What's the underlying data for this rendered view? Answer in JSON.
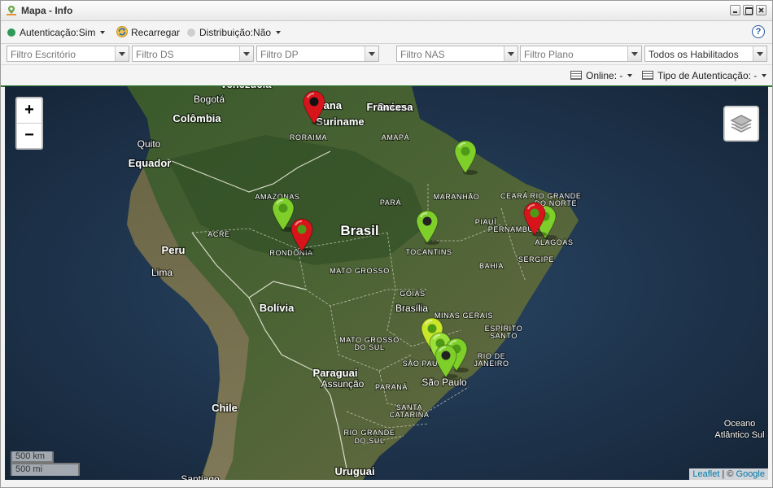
{
  "window": {
    "title": "Mapa - Info"
  },
  "toolbar": {
    "auth": {
      "label": "Autenticação:Sim",
      "dot_color": "#2e9a5a"
    },
    "reload": {
      "label": "Recarregar"
    },
    "distribution": {
      "label": "Distribuição:Não",
      "dot_color": "#cfcfcf"
    },
    "help": "?"
  },
  "filters": [
    {
      "id": "escritorio",
      "placeholder": "Filtro Escritório"
    },
    {
      "id": "ds",
      "placeholder": "Filtro DS"
    },
    {
      "id": "dp",
      "placeholder": "Filtro DP"
    },
    {
      "id": "nas",
      "placeholder": "Filtro NAS"
    },
    {
      "id": "plano",
      "placeholder": "Filtro Plano"
    },
    {
      "id": "habilitados",
      "placeholder": "Todos os Habilitados"
    }
  ],
  "toolbar3": {
    "online": "Online: -",
    "auth_type": "Tipo de Autenticação: -"
  },
  "map": {
    "zoom_in": "+",
    "zoom_out": "−",
    "scale_km": "500 km",
    "scale_mi": "500 mi",
    "attribution_leaflet": "Leaflet",
    "attribution_sep": " | © ",
    "attribution_google": "Google",
    "labels": [
      {
        "text": "Venezuela",
        "size": 13,
        "bold": true
      },
      {
        "text": "Guiana",
        "size": 13,
        "bold": true
      },
      {
        "text": "Guiana",
        "size": 13,
        "bold": true
      },
      {
        "text": "Francesa",
        "size": 13,
        "bold": true
      },
      {
        "text": "Bogotá",
        "size": 12,
        "bold": false
      },
      {
        "text": "Colômbia",
        "size": 13,
        "bold": true
      },
      {
        "text": "Suriname",
        "size": 13,
        "bold": true
      },
      {
        "text": "RORAIMA",
        "size": 9,
        "bold": false
      },
      {
        "text": "AMAPÁ",
        "size": 9,
        "bold": false
      },
      {
        "text": "Quito",
        "size": 12,
        "bold": false
      },
      {
        "text": "Equador",
        "size": 13,
        "bold": true
      },
      {
        "text": "AMAZONAS",
        "size": 9,
        "bold": false
      },
      {
        "text": "PARÁ",
        "size": 9,
        "bold": false
      },
      {
        "text": "MARANHÃO",
        "size": 9,
        "bold": false
      },
      {
        "text": "CEARÁ",
        "size": 9,
        "bold": false
      },
      {
        "text": "RIO GRANDE",
        "size": 9,
        "bold": false
      },
      {
        "text": "DO NORTE",
        "size": 9,
        "bold": false
      },
      {
        "text": "PIAUÍ",
        "size": 9,
        "bold": false
      },
      {
        "text": "PERNAMBUCO",
        "size": 9,
        "bold": false
      },
      {
        "text": "ALAGOAS",
        "size": 9,
        "bold": false
      },
      {
        "text": "Brasil",
        "size": 17,
        "bold": true
      },
      {
        "text": "ACRE",
        "size": 9,
        "bold": false
      },
      {
        "text": "RONDÔNIA",
        "size": 9,
        "bold": false
      },
      {
        "text": "TOCANTINS",
        "size": 9,
        "bold": false
      },
      {
        "text": "SERGIPE",
        "size": 9,
        "bold": false
      },
      {
        "text": "BAHIA",
        "size": 9,
        "bold": false
      },
      {
        "text": "Peru",
        "size": 13,
        "bold": true
      },
      {
        "text": "Lima",
        "size": 12,
        "bold": false
      },
      {
        "text": "MATO GROSSO",
        "size": 9,
        "bold": false
      },
      {
        "text": "GOIÁS",
        "size": 9,
        "bold": false
      },
      {
        "text": "Brasília",
        "size": 12,
        "bold": false
      },
      {
        "text": "Bolívia",
        "size": 13,
        "bold": true
      },
      {
        "text": "MINAS GERAIS",
        "size": 9,
        "bold": false
      },
      {
        "text": "ESPÍRITO",
        "size": 9,
        "bold": false
      },
      {
        "text": "SANTO",
        "size": 9,
        "bold": false
      },
      {
        "text": "MATO GROSSO",
        "size": 9,
        "bold": false
      },
      {
        "text": "DO SUL",
        "size": 9,
        "bold": false
      },
      {
        "text": "RIO DE",
        "size": 9,
        "bold": false
      },
      {
        "text": "JANEIRO",
        "size": 9,
        "bold": false
      },
      {
        "text": "SÃO PAULO",
        "size": 9,
        "bold": false
      },
      {
        "text": "Paraguai",
        "size": 13,
        "bold": true
      },
      {
        "text": "Assunção",
        "size": 12,
        "bold": false
      },
      {
        "text": "São Paulo",
        "size": 12,
        "bold": false
      },
      {
        "text": "PARANÁ",
        "size": 9,
        "bold": false
      },
      {
        "text": "Chile",
        "size": 13,
        "bold": true
      },
      {
        "text": "SANTA",
        "size": 9,
        "bold": false
      },
      {
        "text": "CATARINA",
        "size": 9,
        "bold": false
      },
      {
        "text": "RIO GRANDE",
        "size": 9,
        "bold": false
      },
      {
        "text": "DO SUL",
        "size": 9,
        "bold": false
      },
      {
        "text": "Uruguai",
        "size": 13,
        "bold": true
      },
      {
        "text": "Oceano",
        "size": 11,
        "bold": false
      },
      {
        "text": "Atlântico Sul",
        "size": 11,
        "bold": false
      },
      {
        "text": "Santiago",
        "size": 12,
        "bold": false
      }
    ],
    "markers": [
      {
        "color": "#d8141b",
        "center": "#111"
      },
      {
        "color": "#7fcf2a",
        "center": "#4e9a16"
      },
      {
        "color": "#7fcf2a",
        "center": "#4e9a16"
      },
      {
        "color": "#d8141b",
        "center": "#4e9a16"
      },
      {
        "color": "#7fcf2a",
        "center": "#222"
      },
      {
        "color": "#7fcf2a",
        "center": "#4e9a16"
      },
      {
        "color": "#d8141b",
        "center": "#4e9a16"
      },
      {
        "color": "#c8e62a",
        "center": "#4e9a16"
      },
      {
        "color": "#9be13a",
        "center": "#4e9a16"
      },
      {
        "color": "#7fcf2a",
        "center": "#4e9a16"
      },
      {
        "color": "#7fcf2a",
        "center": "#222"
      }
    ]
  }
}
